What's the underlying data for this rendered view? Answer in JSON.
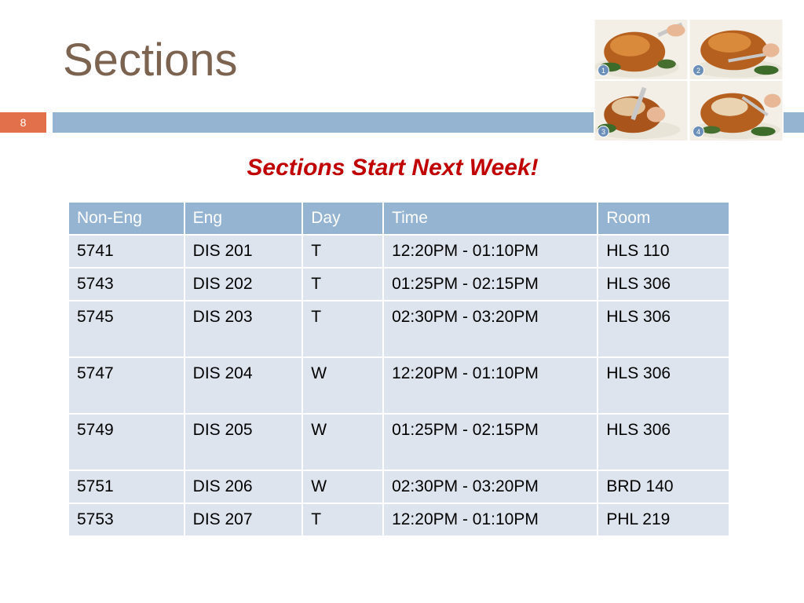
{
  "slide": {
    "title": "Sections",
    "page_number": "8",
    "headline": "Sections Start Next Week!"
  },
  "photos": {
    "steps": [
      "1",
      "2",
      "3",
      "4"
    ]
  },
  "colors": {
    "title": "#7b6350",
    "accent": "#e2704a",
    "header_bar": "#95b4d2",
    "headline": "#c00000",
    "row_fill": "#dde4ee"
  },
  "table": {
    "headers": [
      "Non-Eng",
      "Eng",
      "Day",
      "Time",
      "Room"
    ],
    "rows": [
      [
        "5741",
        "DIS 201",
        "T",
        "12:20PM - 01:10PM",
        "HLS 110"
      ],
      [
        "5743",
        "DIS 202",
        "T",
        "01:25PM - 02:15PM",
        "HLS 306"
      ],
      [
        "5745",
        "DIS 203",
        "T",
        "02:30PM - 03:20PM",
        "HLS 306"
      ],
      [
        "5747",
        "DIS 204",
        "W",
        "12:20PM - 01:10PM",
        "HLS 306"
      ],
      [
        "5749",
        "DIS 205",
        "W",
        "01:25PM - 02:15PM",
        "HLS 306"
      ],
      [
        "5751",
        "DIS 206",
        "W",
        "02:30PM - 03:20PM",
        "BRD 140"
      ],
      [
        "5753",
        "DIS 207",
        "T",
        "12:20PM - 01:10PM",
        "PHL 219"
      ]
    ]
  }
}
